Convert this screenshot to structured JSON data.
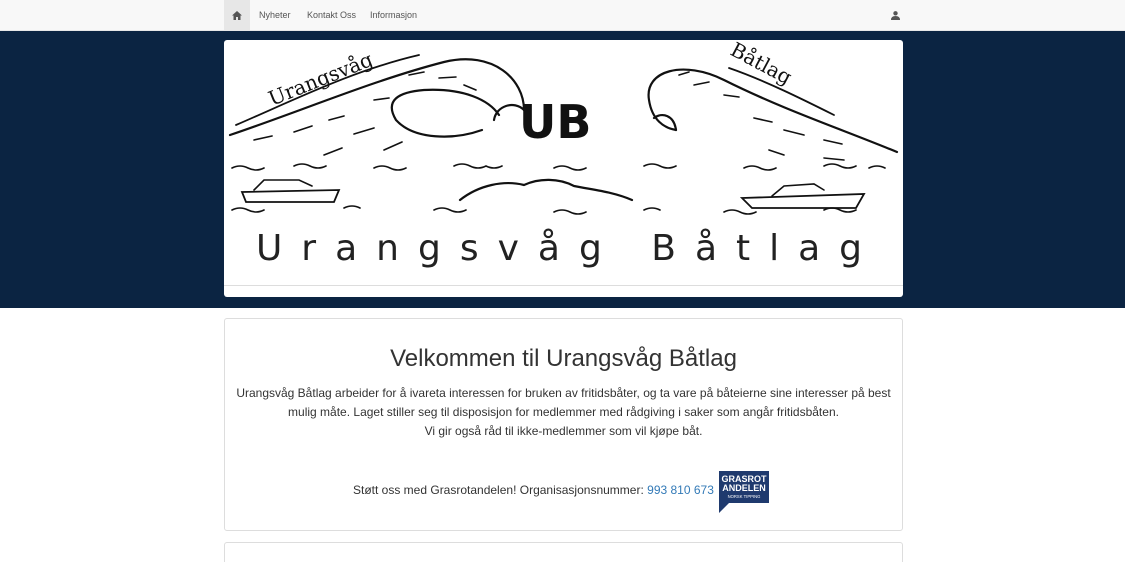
{
  "nav": {
    "home_icon": "home-icon",
    "items": [
      {
        "label": "Nyheter"
      },
      {
        "label": "Kontakt Oss"
      },
      {
        "label": "Informasjon"
      }
    ],
    "user_icon": "user-icon"
  },
  "banner": {
    "title": "Urangsvåg Båtlag",
    "logo_left_text": "Urangsvåg",
    "logo_right_text": "Båtlag",
    "logo_monogram": "UB",
    "background_color": "#0b2442"
  },
  "welcome": {
    "heading": "Velkommen til Urangsvåg Båtlag",
    "paragraph_1": "Urangsvåg Båtlag arbeider for å ivareta interessen for bruken av fritidsbåter, og ta vare på båteierne sine interesser på best mulig måte. Laget stiller seg til disposisjon for medlemmer med rådgiving i saker som angår fritidsbåten.",
    "paragraph_2": "Vi gir også råd til ikke-medlemmer som vil kjøpe båt.",
    "support_text": "Støtt oss med Grasrotandelen! Organisasjonsnummer:",
    "org_number": "993 810 673",
    "grasrot_badge": {
      "line1": "GRASROT",
      "line2": "ANDELEN",
      "line3": "NORSK TIPPING"
    }
  },
  "colors": {
    "link": "#337ab7",
    "badge": "#1f3a6e"
  }
}
